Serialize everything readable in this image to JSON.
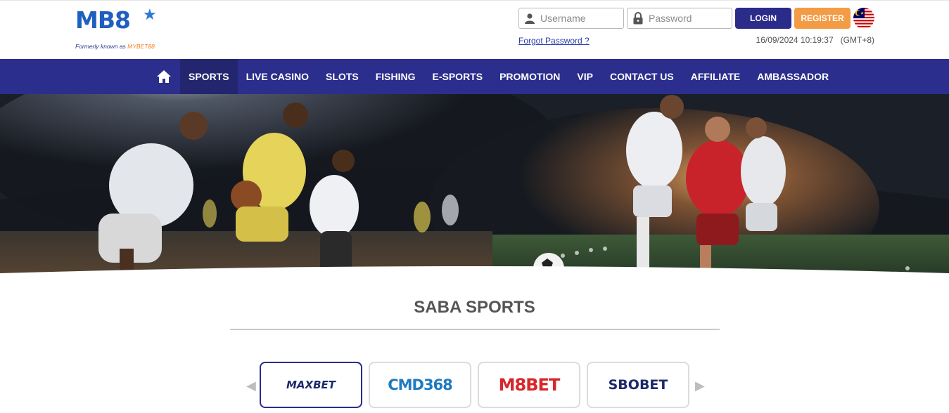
{
  "header": {
    "logo_text": "MB8",
    "logo_tagline_prefix": "Formerly known as ",
    "logo_tagline_brand": "MYBET88",
    "username_placeholder": "Username",
    "password_placeholder": "Password",
    "login_label": "LOGIN",
    "register_label": "REGISTER",
    "forgot_password": "Forgot Password ?",
    "datetime": "16/09/2024 10:19:37",
    "timezone": "(GMT+8)",
    "language_flag": "malaysia-flag-icon"
  },
  "nav": {
    "home_icon": "home-icon",
    "items": [
      {
        "label": "SPORTS",
        "active": true
      },
      {
        "label": "LIVE CASINO"
      },
      {
        "label": "SLOTS"
      },
      {
        "label": "FISHING"
      },
      {
        "label": "E-SPORTS"
      },
      {
        "label": "PROMOTION"
      },
      {
        "label": "VIP"
      },
      {
        "label": "CONTACT US"
      },
      {
        "label": "AFFILIATE"
      },
      {
        "label": "AMBASSADOR"
      }
    ]
  },
  "main": {
    "section_title": "SABA SPORTS",
    "providers": [
      {
        "label": "MAXBET",
        "active": true
      },
      {
        "label": "CMD368"
      },
      {
        "label": "M8BET"
      },
      {
        "label": "SBOBET"
      }
    ]
  },
  "colors": {
    "nav_bg": "#2b2e8c",
    "login_bg": "#2b2b8a",
    "register_bg": "#f39c45",
    "brand_blue": "#1f5fbf",
    "brand_orange": "#f47d20"
  }
}
